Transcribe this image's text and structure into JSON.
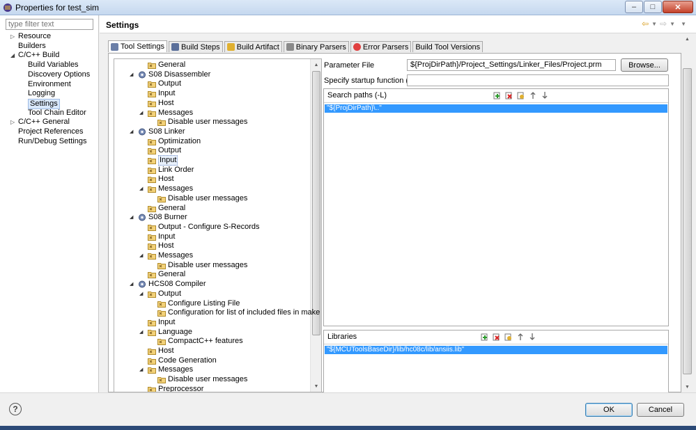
{
  "window": {
    "title": "Properties for test_sim"
  },
  "filter": {
    "placeholder": "type filter text"
  },
  "nav": [
    {
      "label": "Resource",
      "level": 0,
      "twisty": "closed"
    },
    {
      "label": "Builders",
      "level": 0,
      "twisty": "none"
    },
    {
      "label": "C/C++ Build",
      "level": 0,
      "twisty": "open"
    },
    {
      "label": "Build Variables",
      "level": 1,
      "twisty": "none"
    },
    {
      "label": "Discovery Options",
      "level": 1,
      "twisty": "none"
    },
    {
      "label": "Environment",
      "level": 1,
      "twisty": "none"
    },
    {
      "label": "Logging",
      "level": 1,
      "twisty": "none"
    },
    {
      "label": "Settings",
      "level": 1,
      "twisty": "none",
      "selected": true
    },
    {
      "label": "Tool Chain Editor",
      "level": 1,
      "twisty": "none"
    },
    {
      "label": "C/C++ General",
      "level": 0,
      "twisty": "closed"
    },
    {
      "label": "Project References",
      "level": 0,
      "twisty": "none"
    },
    {
      "label": "Run/Debug Settings",
      "level": 0,
      "twisty": "none"
    }
  ],
  "settings": {
    "title": "Settings"
  },
  "tabs": [
    {
      "label": "Tool Settings",
      "icon": "tool-settings-icon",
      "active": true
    },
    {
      "label": "Build Steps",
      "icon": "build-steps-icon"
    },
    {
      "label": "Build Artifact",
      "icon": "build-artifact-icon"
    },
    {
      "label": "Binary Parsers",
      "icon": "binary-parsers-icon"
    },
    {
      "label": "Error Parsers",
      "icon": "error-parsers-icon"
    },
    {
      "label": "Build Tool Versions",
      "icon": ""
    }
  ],
  "tree": [
    {
      "label": "General",
      "level": 1,
      "type": "option",
      "twisty": "none"
    },
    {
      "label": "S08 Disassembler",
      "level": 0,
      "type": "tool",
      "twisty": "open"
    },
    {
      "label": "Output",
      "level": 1,
      "type": "option",
      "twisty": "none"
    },
    {
      "label": "Input",
      "level": 1,
      "type": "option",
      "twisty": "none"
    },
    {
      "label": "Host",
      "level": 1,
      "type": "option",
      "twisty": "none"
    },
    {
      "label": "Messages",
      "level": 1,
      "type": "option",
      "twisty": "open"
    },
    {
      "label": "Disable user messages",
      "level": 2,
      "type": "option",
      "twisty": "none"
    },
    {
      "label": "S08 Linker",
      "level": 0,
      "type": "tool",
      "twisty": "open"
    },
    {
      "label": "Optimization",
      "level": 1,
      "type": "option",
      "twisty": "none"
    },
    {
      "label": "Output",
      "level": 1,
      "type": "option",
      "twisty": "none"
    },
    {
      "label": "Input",
      "level": 1,
      "type": "option",
      "twisty": "none",
      "selected": true
    },
    {
      "label": "Link Order",
      "level": 1,
      "type": "option",
      "twisty": "none"
    },
    {
      "label": "Host",
      "level": 1,
      "type": "option",
      "twisty": "none"
    },
    {
      "label": "Messages",
      "level": 1,
      "type": "option",
      "twisty": "open"
    },
    {
      "label": "Disable user messages",
      "level": 2,
      "type": "option",
      "twisty": "none"
    },
    {
      "label": "General",
      "level": 1,
      "type": "option",
      "twisty": "none"
    },
    {
      "label": "S08 Burner",
      "level": 0,
      "type": "tool",
      "twisty": "open"
    },
    {
      "label": "Output - Configure S-Records",
      "level": 1,
      "type": "option",
      "twisty": "none"
    },
    {
      "label": "Input",
      "level": 1,
      "type": "option",
      "twisty": "none"
    },
    {
      "label": "Host",
      "level": 1,
      "type": "option",
      "twisty": "none"
    },
    {
      "label": "Messages",
      "level": 1,
      "type": "option",
      "twisty": "open"
    },
    {
      "label": "Disable user messages",
      "level": 2,
      "type": "option",
      "twisty": "none"
    },
    {
      "label": "General",
      "level": 1,
      "type": "option",
      "twisty": "none"
    },
    {
      "label": "HCS08 Compiler",
      "level": 0,
      "type": "tool",
      "twisty": "open"
    },
    {
      "label": "Output",
      "level": 1,
      "type": "option",
      "twisty": "open"
    },
    {
      "label": "Configure Listing File",
      "level": 2,
      "type": "option",
      "twisty": "none"
    },
    {
      "label": "Configuration for list of included files in make format",
      "level": 2,
      "type": "option",
      "twisty": "none"
    },
    {
      "label": "Input",
      "level": 1,
      "type": "option",
      "twisty": "none"
    },
    {
      "label": "Language",
      "level": 1,
      "type": "option",
      "twisty": "open"
    },
    {
      "label": "CompactC++ features",
      "level": 2,
      "type": "option",
      "twisty": "none"
    },
    {
      "label": "Host",
      "level": 1,
      "type": "option",
      "twisty": "none"
    },
    {
      "label": "Code Generation",
      "level": 1,
      "type": "option",
      "twisty": "none"
    },
    {
      "label": "Messages",
      "level": 1,
      "type": "option",
      "twisty": "open"
    },
    {
      "label": "Disable user messages",
      "level": 2,
      "type": "option",
      "twisty": "none"
    },
    {
      "label": "Preprocessor",
      "level": 1,
      "type": "option",
      "twisty": "none"
    }
  ],
  "form": {
    "param_label": "Parameter File",
    "param_value": "${ProjDirPath}/Project_Settings/Linker_Files/Project.prm",
    "browse_label": "Browse...",
    "startup_label": "Specify startup function (-E)",
    "startup_value": ""
  },
  "search_paths": {
    "title": "Search paths (-L)",
    "items": [
      "\"${ProjDirPath}\\..\""
    ]
  },
  "libraries": {
    "title": "Libraries",
    "items": [
      "\"${MCUToolsBaseDir}/lib/hc08c/lib/ansiis.lib\""
    ]
  },
  "buttons": {
    "ok": "OK",
    "cancel": "Cancel",
    "help": "?"
  },
  "colors": {
    "selection": "#3399ff",
    "titlebar": "#c5d8ef",
    "ok_border": "#3c7fb1"
  }
}
